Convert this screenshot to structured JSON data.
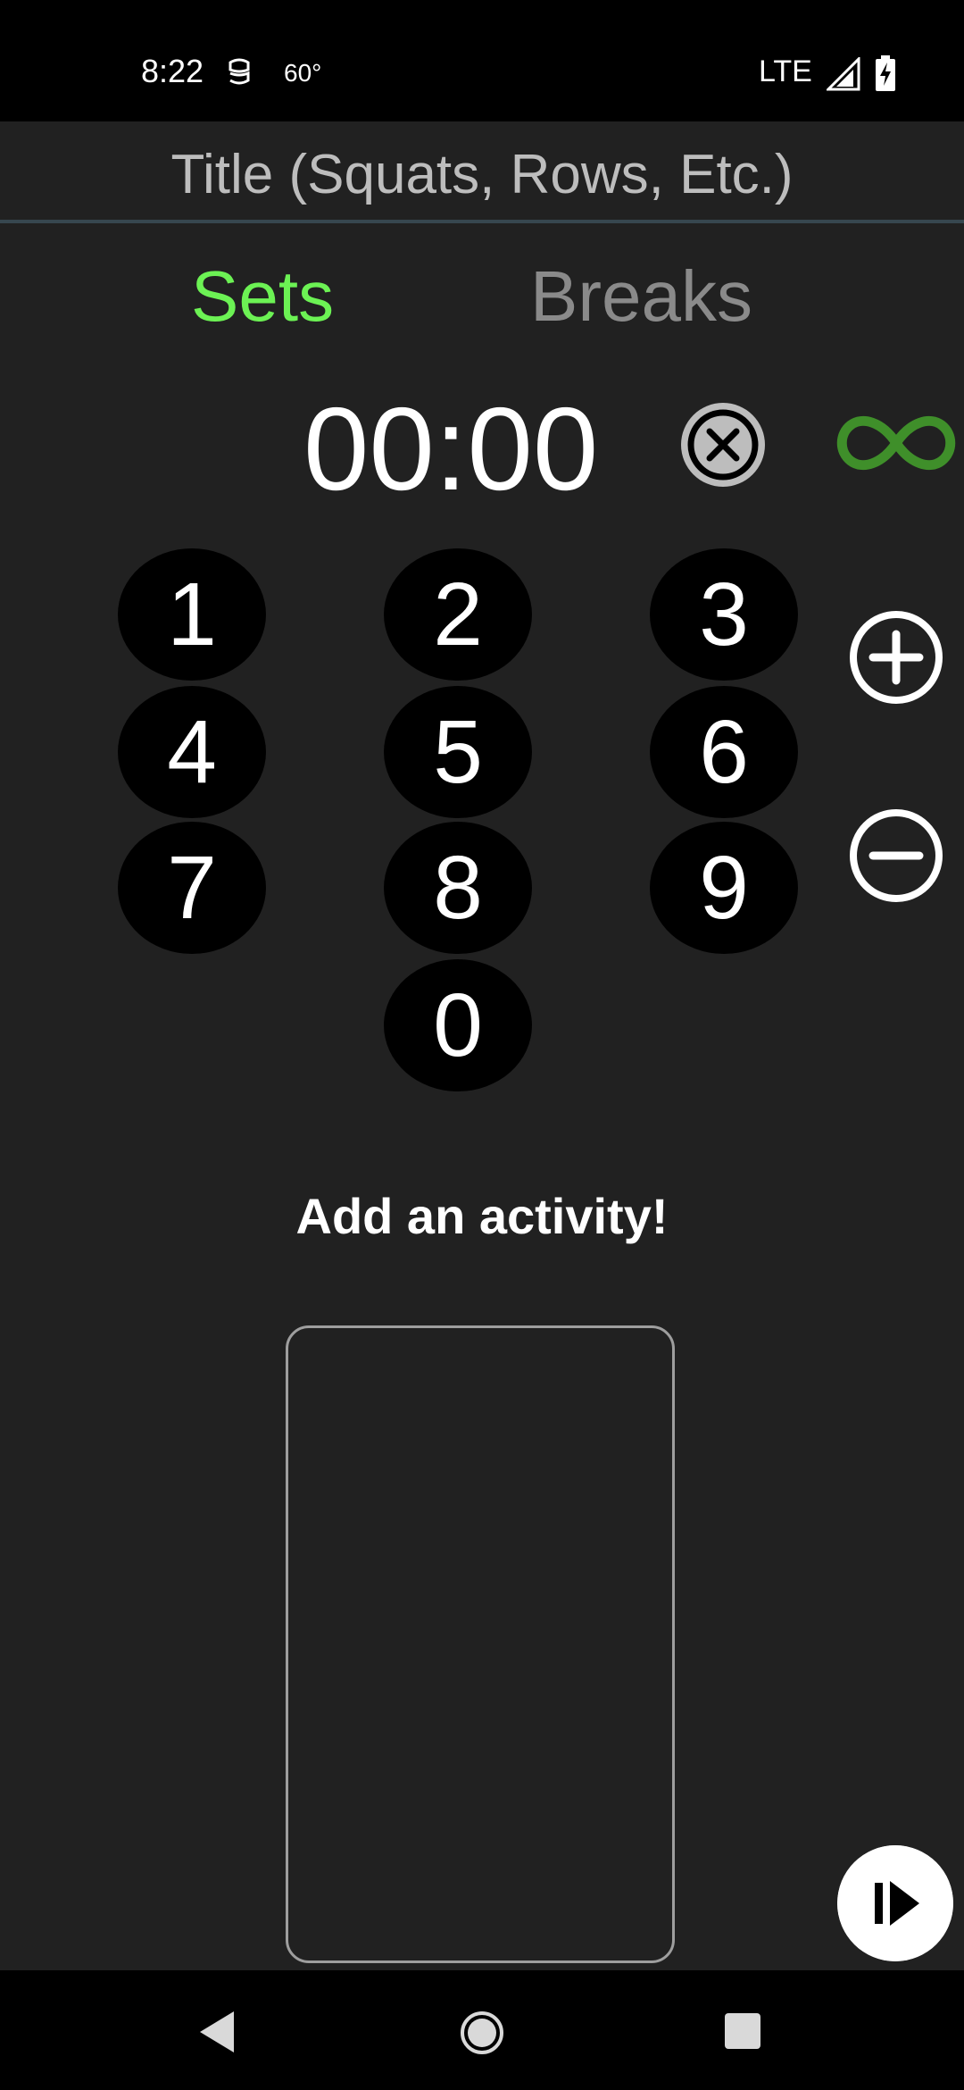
{
  "status_bar": {
    "time": "8:22",
    "temperature": "60°",
    "network": "LTE"
  },
  "title_field": {
    "placeholder": "Title (Squats, Rows, Etc.)"
  },
  "tabs": {
    "sets": "Sets",
    "breaks": "Breaks",
    "active": "sets",
    "active_color": "#6cf254",
    "inactive_color": "#8a8a8a"
  },
  "timer": {
    "display": "00:00"
  },
  "keypad": {
    "keys": [
      "1",
      "2",
      "3",
      "4",
      "5",
      "6",
      "7",
      "8",
      "9",
      "0"
    ]
  },
  "activity": {
    "prompt": "Add an activity!"
  },
  "icons": {
    "clear": "clear-circle-x-icon",
    "infinity": "infinity-icon",
    "plus": "plus-circle-icon",
    "minus": "minus-circle-icon",
    "play": "play-pause-icon",
    "infinity_color": "#3f8f2a"
  }
}
